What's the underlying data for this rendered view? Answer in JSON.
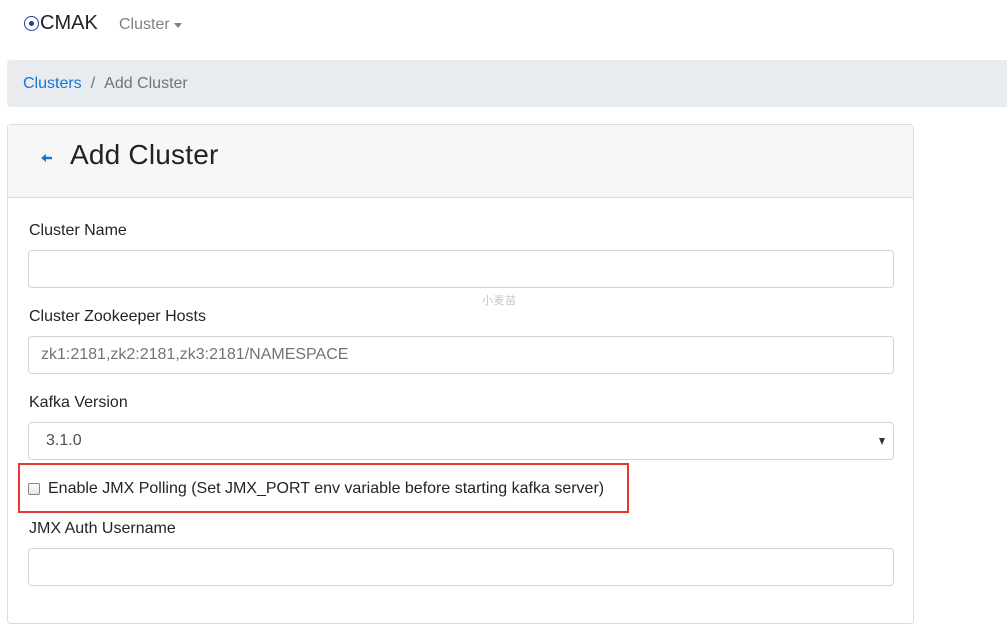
{
  "navbar": {
    "brand": "CMAK",
    "cluster_menu": "Cluster"
  },
  "breadcrumb": {
    "link": "Clusters",
    "separator": "/",
    "current": "Add Cluster"
  },
  "card": {
    "title": "Add Cluster",
    "watermark": "小麦苗",
    "fields": {
      "cluster_name": {
        "label": "Cluster Name",
        "value": "",
        "placeholder": ""
      },
      "zk_hosts": {
        "label": "Cluster Zookeeper Hosts",
        "value": "",
        "placeholder": "zk1:2181,zk2:2181,zk3:2181/NAMESPACE"
      },
      "kafka_version": {
        "label": "Kafka Version",
        "selected": "3.1.0"
      },
      "jmx_polling": {
        "label": "Enable JMX Polling (Set JMX_PORT env variable before starting kafka server)",
        "checked": false
      },
      "jmx_username": {
        "label": "JMX Auth Username",
        "value": "",
        "placeholder": ""
      }
    }
  },
  "colors": {
    "link": "#1a73d9",
    "highlight_border": "#e53935",
    "breadcrumb_bg": "#e9ecef",
    "card_header_bg": "#f7f7f7"
  }
}
